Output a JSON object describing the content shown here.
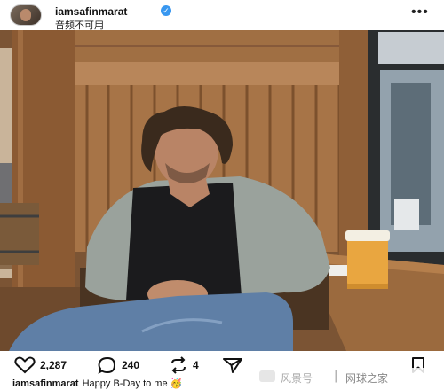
{
  "header": {
    "username": "iamsafinmarat",
    "verified_icon": "verified-badge-icon",
    "audio_text": "音频不可用",
    "more_icon": "more-icon",
    "more_glyph": "•••"
  },
  "photo": {
    "alt": "Photo of a man sitting by a window in a wood-paneled bar with a glass of beer",
    "colors": {
      "wood": "#9a6a40",
      "wood_dark": "#5e3c22",
      "shirt": "#1b1b1d",
      "jacket": "#9aa29c",
      "jeans": "#5f7fa6",
      "beer": "#e9a640"
    }
  },
  "actions": {
    "like_icon": "heart-icon",
    "likes": "2,287",
    "comment_icon": "comment-icon",
    "comments": "240",
    "repost_icon": "repost-icon",
    "reposts": "4",
    "share_icon": "share-icon",
    "save_icon": "bookmark-icon"
  },
  "caption": {
    "username": "iamsafinmarat",
    "text": "Happy B-Day to me",
    "emoji": "🥳"
  },
  "watermark": {
    "left": "风景号",
    "separator": "|",
    "right": "网球之家"
  }
}
